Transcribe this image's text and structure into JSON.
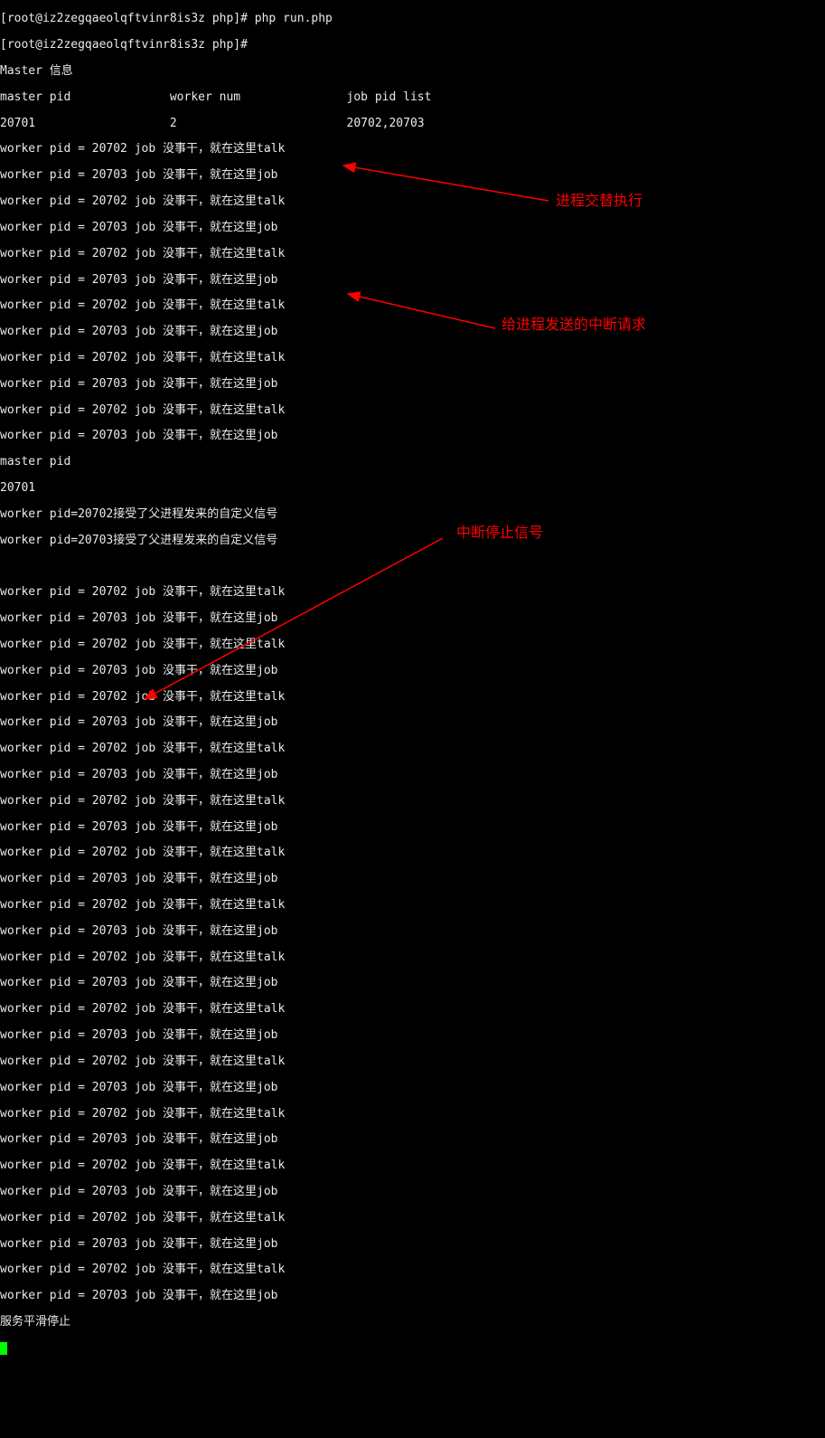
{
  "prompt_user": "root",
  "prompt_host": "iz2zegqaeolqftvinr8is3z",
  "prompt_dir": "php",
  "cmd1": "php run.php",
  "cmd2": "",
  "master_header": "Master 信息",
  "master_cols": "master pid              worker num               job pid list",
  "master_row": "20701                   2                        20702,20703",
  "lines_a": [
    "worker pid = 20702 job 没事干，就在这里talk",
    "worker pid = 20703 job 没事干，就在这里job",
    "worker pid = 20702 job 没事干，就在这里talk",
    "worker pid = 20703 job 没事干，就在这里job",
    "worker pid = 20702 job 没事干，就在这里talk",
    "worker pid = 20703 job 没事干，就在这里job",
    "worker pid = 20702 job 没事干，就在这里talk",
    "worker pid = 20703 job 没事干，就在这里job",
    "worker pid = 20702 job 没事干，就在这里talk",
    "worker pid = 20703 job 没事干，就在这里job",
    "worker pid = 20702 job 没事干，就在这里talk",
    "worker pid = 20703 job 没事干，就在这里job"
  ],
  "master_pid_label": "master pid",
  "master_pid_value": "20701",
  "interrupt_lines": [
    "worker pid=20702接受了父进程发来的自定义信号",
    "worker pid=20703接受了父进程发来的自定义信号"
  ],
  "lines_b": [
    "worker pid = 20702 job 没事干，就在这里talk",
    "worker pid = 20703 job 没事干，就在这里job",
    "worker pid = 20702 job 没事干，就在这里talk",
    "worker pid = 20703 job 没事干，就在这里job",
    "worker pid = 20702 job 没事干，就在这里talk",
    "worker pid = 20703 job 没事干，就在这里job",
    "worker pid = 20702 job 没事干，就在这里talk",
    "worker pid = 20703 job 没事干，就在这里job",
    "worker pid = 20702 job 没事干，就在这里talk",
    "worker pid = 20703 job 没事干，就在这里job",
    "worker pid = 20702 job 没事干，就在这里talk",
    "worker pid = 20703 job 没事干，就在这里job",
    "worker pid = 20702 job 没事干，就在这里talk",
    "worker pid = 20703 job 没事干，就在这里job",
    "worker pid = 20702 job 没事干，就在这里talk",
    "worker pid = 20703 job 没事干，就在这里job",
    "worker pid = 20702 job 没事干，就在这里talk",
    "worker pid = 20703 job 没事干，就在这里job",
    "worker pid = 20702 job 没事干，就在这里talk",
    "worker pid = 20703 job 没事干，就在这里job",
    "worker pid = 20702 job 没事干，就在这里talk",
    "worker pid = 20703 job 没事干，就在这里job",
    "worker pid = 20702 job 没事干，就在这里talk",
    "worker pid = 20703 job 没事干，就在这里job",
    "worker pid = 20702 job 没事干，就在这里talk",
    "worker pid = 20703 job 没事干，就在这里job",
    "worker pid = 20702 job 没事干，就在这里talk",
    "worker pid = 20703 job 没事干，就在这里job"
  ],
  "stop_line": "服务平滑停止",
  "annotations": {
    "a1": "进程交替执行",
    "a2": "给进程发送的中断请求",
    "a3": "中断停止信号"
  },
  "colors": {
    "fg": "#eaeaea",
    "bg": "#000000",
    "annotation": "#ff0000",
    "cursor": "#00ff00"
  }
}
